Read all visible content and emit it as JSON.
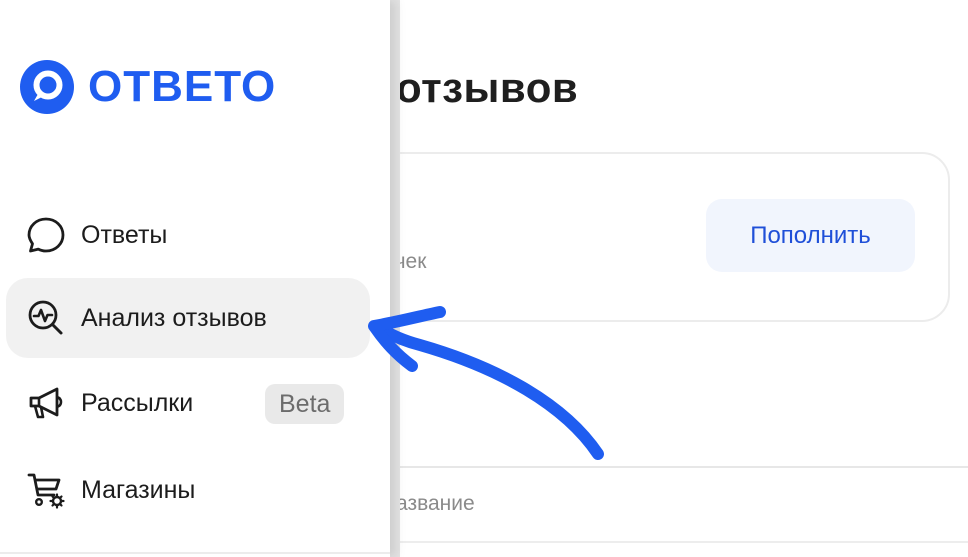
{
  "app": {
    "logo_text": "ОТВЕТО",
    "brand_color": "#1f5df0",
    "accent_color": "#1f4fd8"
  },
  "sidebar": {
    "items": [
      {
        "label": "Ответы",
        "icon": "chat-bubble-icon"
      },
      {
        "label": "Анализ отзывов",
        "icon": "search-analytics-icon",
        "active": true
      },
      {
        "label": "Рассылки",
        "icon": "megaphone-icon",
        "badge": "Beta"
      },
      {
        "label": "Магазины",
        "icon": "cart-settings-icon"
      }
    ]
  },
  "main": {
    "title": "отзывов",
    "balance_card": {
      "hint": "точек",
      "topup_label": "Пополнить"
    },
    "table": {
      "header_name": "азвание"
    }
  },
  "annotation": {
    "icon": "arrow-pointer-icon",
    "color": "#1f5df0"
  }
}
